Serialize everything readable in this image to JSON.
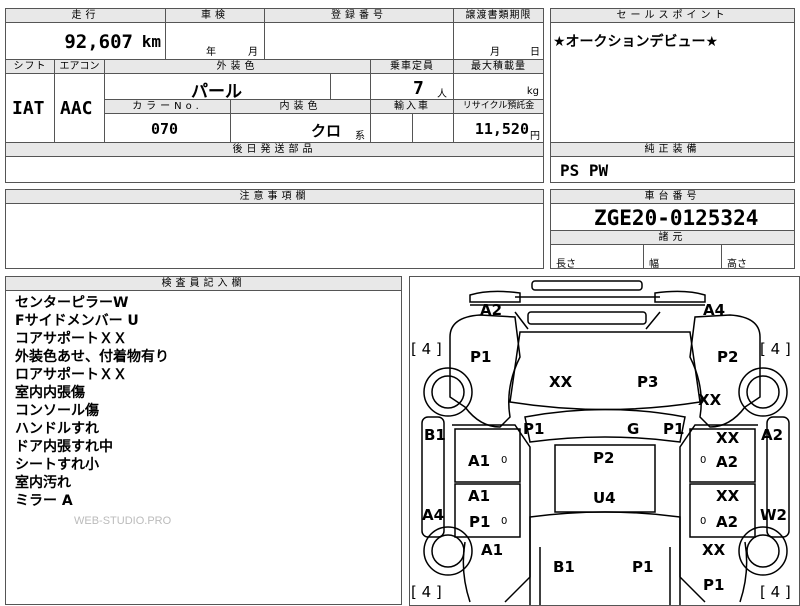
{
  "top_row": {
    "mileage_header": "走行",
    "mileage_value": "92,607",
    "mileage_unit": "km",
    "shaken_header": "車検",
    "shaken_year": "年",
    "shaken_month": "月",
    "registration_header": "登録番号",
    "transfer_header": "譲渡書類期限",
    "transfer_month": "月",
    "transfer_day": "日",
    "shift_header": "シフト",
    "shift_value": "IAT",
    "aircon_header": "エアコン",
    "aircon_value": "AAC",
    "exterior_color_header": "外装色",
    "exterior_color_value": "パール",
    "capacity_header": "乗車定員",
    "capacity_value": "7",
    "capacity_unit": "人",
    "max_load_header": "最大積載量",
    "max_load_unit": "kg",
    "color_no_header": "カラーNo.",
    "color_no_value": "070",
    "interior_color_header": "内装色",
    "interior_color_value": "クロ",
    "interior_color_suffix": "系",
    "import_header": "輸入車",
    "recycle_header": "リサイクル預託金",
    "recycle_value": "11,520",
    "recycle_unit": "円",
    "later_parts_header": "後日発送部品",
    "later_parts_value": ""
  },
  "sales_point": {
    "header": "セールスポイント",
    "text": "★オークションデビュー★"
  },
  "genuine_equipment": {
    "header": "純正装備",
    "value": "PS PW"
  },
  "caution": {
    "header": "注意事項欄",
    "text": ""
  },
  "chassis": {
    "header": "車台番号",
    "value": "ZGE20-0125324",
    "dimensions_header": "諸元",
    "length_label": "長さ",
    "width_label": "幅",
    "height_label": "高さ"
  },
  "inspector": {
    "header": "検査員記入欄",
    "notes": [
      "センターピラーW",
      "Fサイドメンバー U",
      "コアサポートＸＸ",
      "外装色あせ、付着物有り",
      "ロアサポートＸＸ",
      "室内内張傷",
      "コンソール傷",
      "ハンドルすれ",
      "ドア内張すれ中",
      "シートすれ小",
      "室内汚れ",
      "ミラー A"
    ],
    "watermark": "WEB-STUDIO.PRO"
  },
  "diagram": {
    "labels": {
      "a2_front_left": "A2",
      "a4_front_right": "A4",
      "tire_fl": "[ 4 ]",
      "tire_fr": "[ 4 ]",
      "tire_rl": "[ 4 ]",
      "tire_rr": "[ 4 ]",
      "p1_fender_left": "P1",
      "p2_fender_right": "P2",
      "xx_hood_left": "XX",
      "p3_hood_right": "P3",
      "xx_fender_right": "XX",
      "b1_left": "B1",
      "p1_pillar_left": "P1",
      "g_windshield": "G",
      "p1_pillar_right": "P1",
      "xx_right_door_front": "XX",
      "a2_right_edge": "A2",
      "a1_left_door_front": "A1",
      "o_small_1": "0",
      "p2_roof": "P2",
      "o_small_2": "0",
      "a2_right_door_front": "A2",
      "a1_left_door_rear": "A1",
      "u4_roof": "U4",
      "xx_right_door_rear": "XX",
      "a4_left_edge": "A4",
      "p1_left_door_rear": "P1",
      "o_small_3": "0",
      "o_small_4": "0",
      "a2_right_door_rear": "A2",
      "w2_right_edge": "W2",
      "a1_left_quarter": "A1",
      "xx_right_quarter": "XX",
      "b1_rear": "B1",
      "p1_rear": "P1",
      "p1_right_quarter": "P1"
    }
  }
}
